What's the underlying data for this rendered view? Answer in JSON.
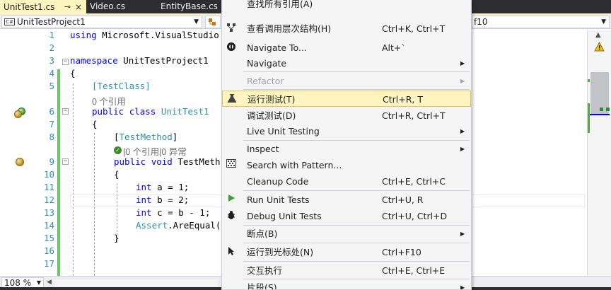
{
  "tabs": [
    {
      "label": "UnitTest1.cs",
      "pin": "⊸",
      "close": "×"
    },
    {
      "label": "Video.cs"
    },
    {
      "label": "EntityBase.cs"
    }
  ],
  "navbar": {
    "project_badge": "C#",
    "project": "UnitTestProject1",
    "member_partial": "f10"
  },
  "editor": {
    "line_numbers": [
      "1",
      "2",
      "3",
      "4",
      "5",
      "6",
      "7",
      "8",
      "9",
      "10",
      "11",
      "12",
      "13",
      "14",
      "15",
      "16",
      "17"
    ],
    "code": {
      "l1_kw": "using",
      "l1_rest": " Microsoft.VisualStudio",
      "l3_kw": "namespace",
      "l3_rest": " UnitTestProject1",
      "l4": "{",
      "l5": "[TestClass]",
      "lens1": "0 个引用",
      "l6_kw1": "public",
      "l6_kw2": "class",
      "l6_type": "UnitTest1",
      "l7": "{",
      "l8_open": "[",
      "l8_attr": "TestMethod",
      "l8_close": "]",
      "lens2": "|0 个引用|0 异常",
      "l9_kw1": "public",
      "l9_kw2": "void",
      "l9_rest": " TestMeth",
      "l10": "{",
      "l11_kw": "int",
      "l11_rest": " a = 1;",
      "l12_kw": "int",
      "l12_rest": " b = 2;",
      "l13_kw": "int",
      "l13_rest": " c = b - 1;",
      "l14_type": "Assert",
      "l14_rest": ".AreEqual(",
      "l15": "}"
    }
  },
  "zoom": "108 %",
  "context_menu": {
    "items": [
      {
        "label": "查找所有引用(A)",
        "shortcut": ""
      },
      {
        "label": "查看调用层次结构(H)",
        "shortcut": "Ctrl+K, Ctrl+T",
        "icon": "call-hierarchy-icon"
      },
      {
        "label": "Navigate To...",
        "shortcut": "Alt+`",
        "icon": "navigate-to-icon"
      },
      {
        "label": "Navigate",
        "shortcut": "",
        "submenu": "▶"
      },
      {
        "label": "Refactor",
        "shortcut": "",
        "submenu": "▶",
        "disabled": true
      },
      {
        "label": "运行测试(T)",
        "shortcut": "Ctrl+R, T",
        "icon": "flask-icon",
        "highlighted": true
      },
      {
        "label": "调试测试(D)",
        "shortcut": "Ctrl+R, Ctrl+T"
      },
      {
        "label": "Live Unit Testing",
        "shortcut": "",
        "submenu": "▶"
      },
      {
        "label": "Inspect",
        "shortcut": "",
        "submenu": "▶"
      },
      {
        "label": "Search with Pattern...",
        "shortcut": "",
        "icon": "pattern-search-icon"
      },
      {
        "label": "Cleanup Code",
        "shortcut": "Ctrl+E, Ctrl+C"
      },
      {
        "label": "Run Unit Tests",
        "shortcut": "Ctrl+U, R",
        "icon": "run-icon"
      },
      {
        "label": "Debug Unit Tests",
        "shortcut": "Ctrl+U, Ctrl+D",
        "icon": "debug-icon"
      },
      {
        "label": "断点(B)",
        "shortcut": "",
        "submenu": "▶"
      },
      {
        "label": "运行到光标处(N)",
        "shortcut": "Ctrl+F10",
        "icon": "cursor-icon"
      },
      {
        "label": "交互执行",
        "shortcut": "Ctrl+E, Ctrl+E"
      },
      {
        "label": "片段(S)",
        "shortcut": "",
        "submenu": "▶"
      }
    ]
  },
  "colors": {
    "tab_active": "#fdf4bf",
    "menu_highlight": "#fdf4bf",
    "keyword": "#0000ff",
    "type": "#2b91af",
    "change_bar": "#6ac46a"
  }
}
